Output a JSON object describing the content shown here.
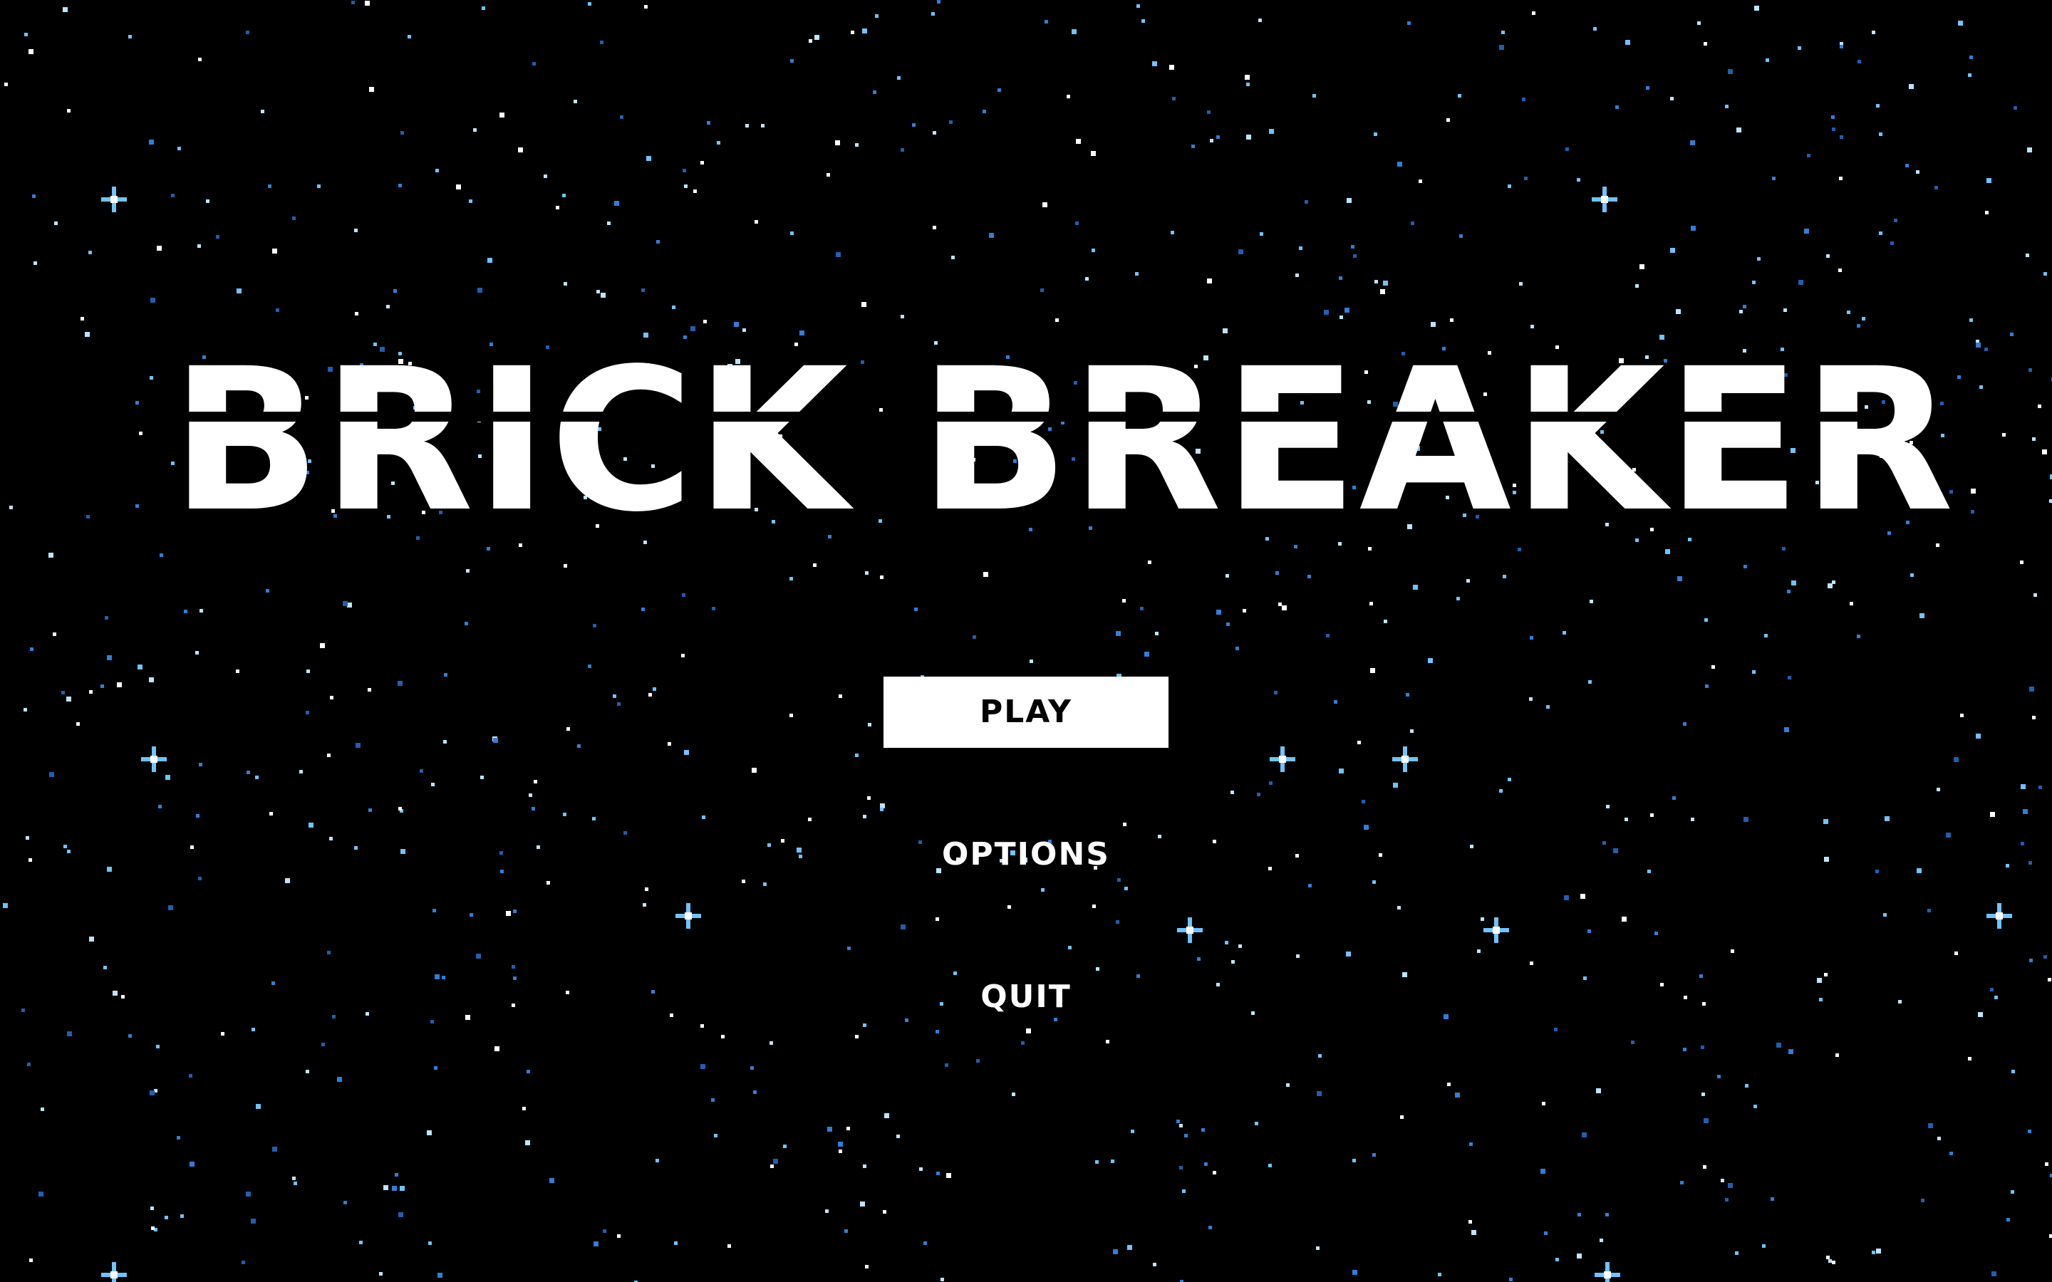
{
  "game": {
    "title": "BRICK BREAKER",
    "background_color": "#000000",
    "star_colors": [
      "#ffffff",
      "#bde4ff",
      "#6fc3ff",
      "#2f7fd8",
      "#1f5fb0"
    ]
  },
  "menu": {
    "play_label": "PLAY",
    "options_label": "OPTIONS",
    "quit_label": "QUIT",
    "selected": "PLAY",
    "selected_bg": "#ffffff",
    "selected_fg": "#000000",
    "text_color": "#ffffff"
  }
}
